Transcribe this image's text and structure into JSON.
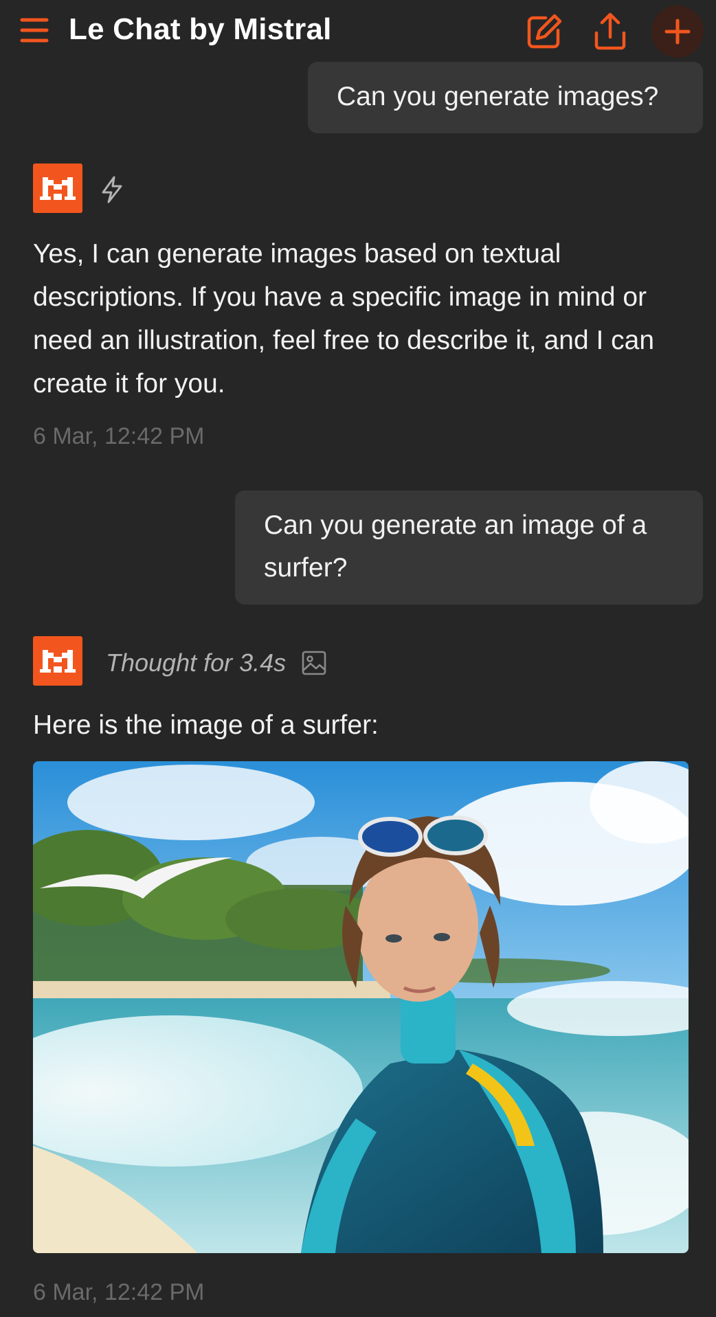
{
  "header": {
    "title": "Le Chat by Mistral",
    "icons": [
      "menu-icon",
      "edit-icon",
      "share-icon",
      "plus-icon"
    ],
    "accent_color": "#f2561e"
  },
  "messages": [
    {
      "role": "user",
      "text": "Can you generate images?"
    },
    {
      "role": "assistant",
      "mode_icon": "lightning-icon",
      "text": "Yes, I can generate images based on textual descriptions. If you have a specific image in mind or need an illustration, feel free to describe it, and I can create it for you.",
      "timestamp": "6 Mar, 12:42 PM"
    },
    {
      "role": "user",
      "text": "Can you generate an image of a surfer?"
    },
    {
      "role": "assistant",
      "thought_label": "Thought for 3.4s",
      "tool_icon": "image-icon",
      "text": "Here is the image of a surfer:",
      "image": "generated-surfer-image",
      "timestamp": "6 Mar, 12:42 PM"
    }
  ]
}
